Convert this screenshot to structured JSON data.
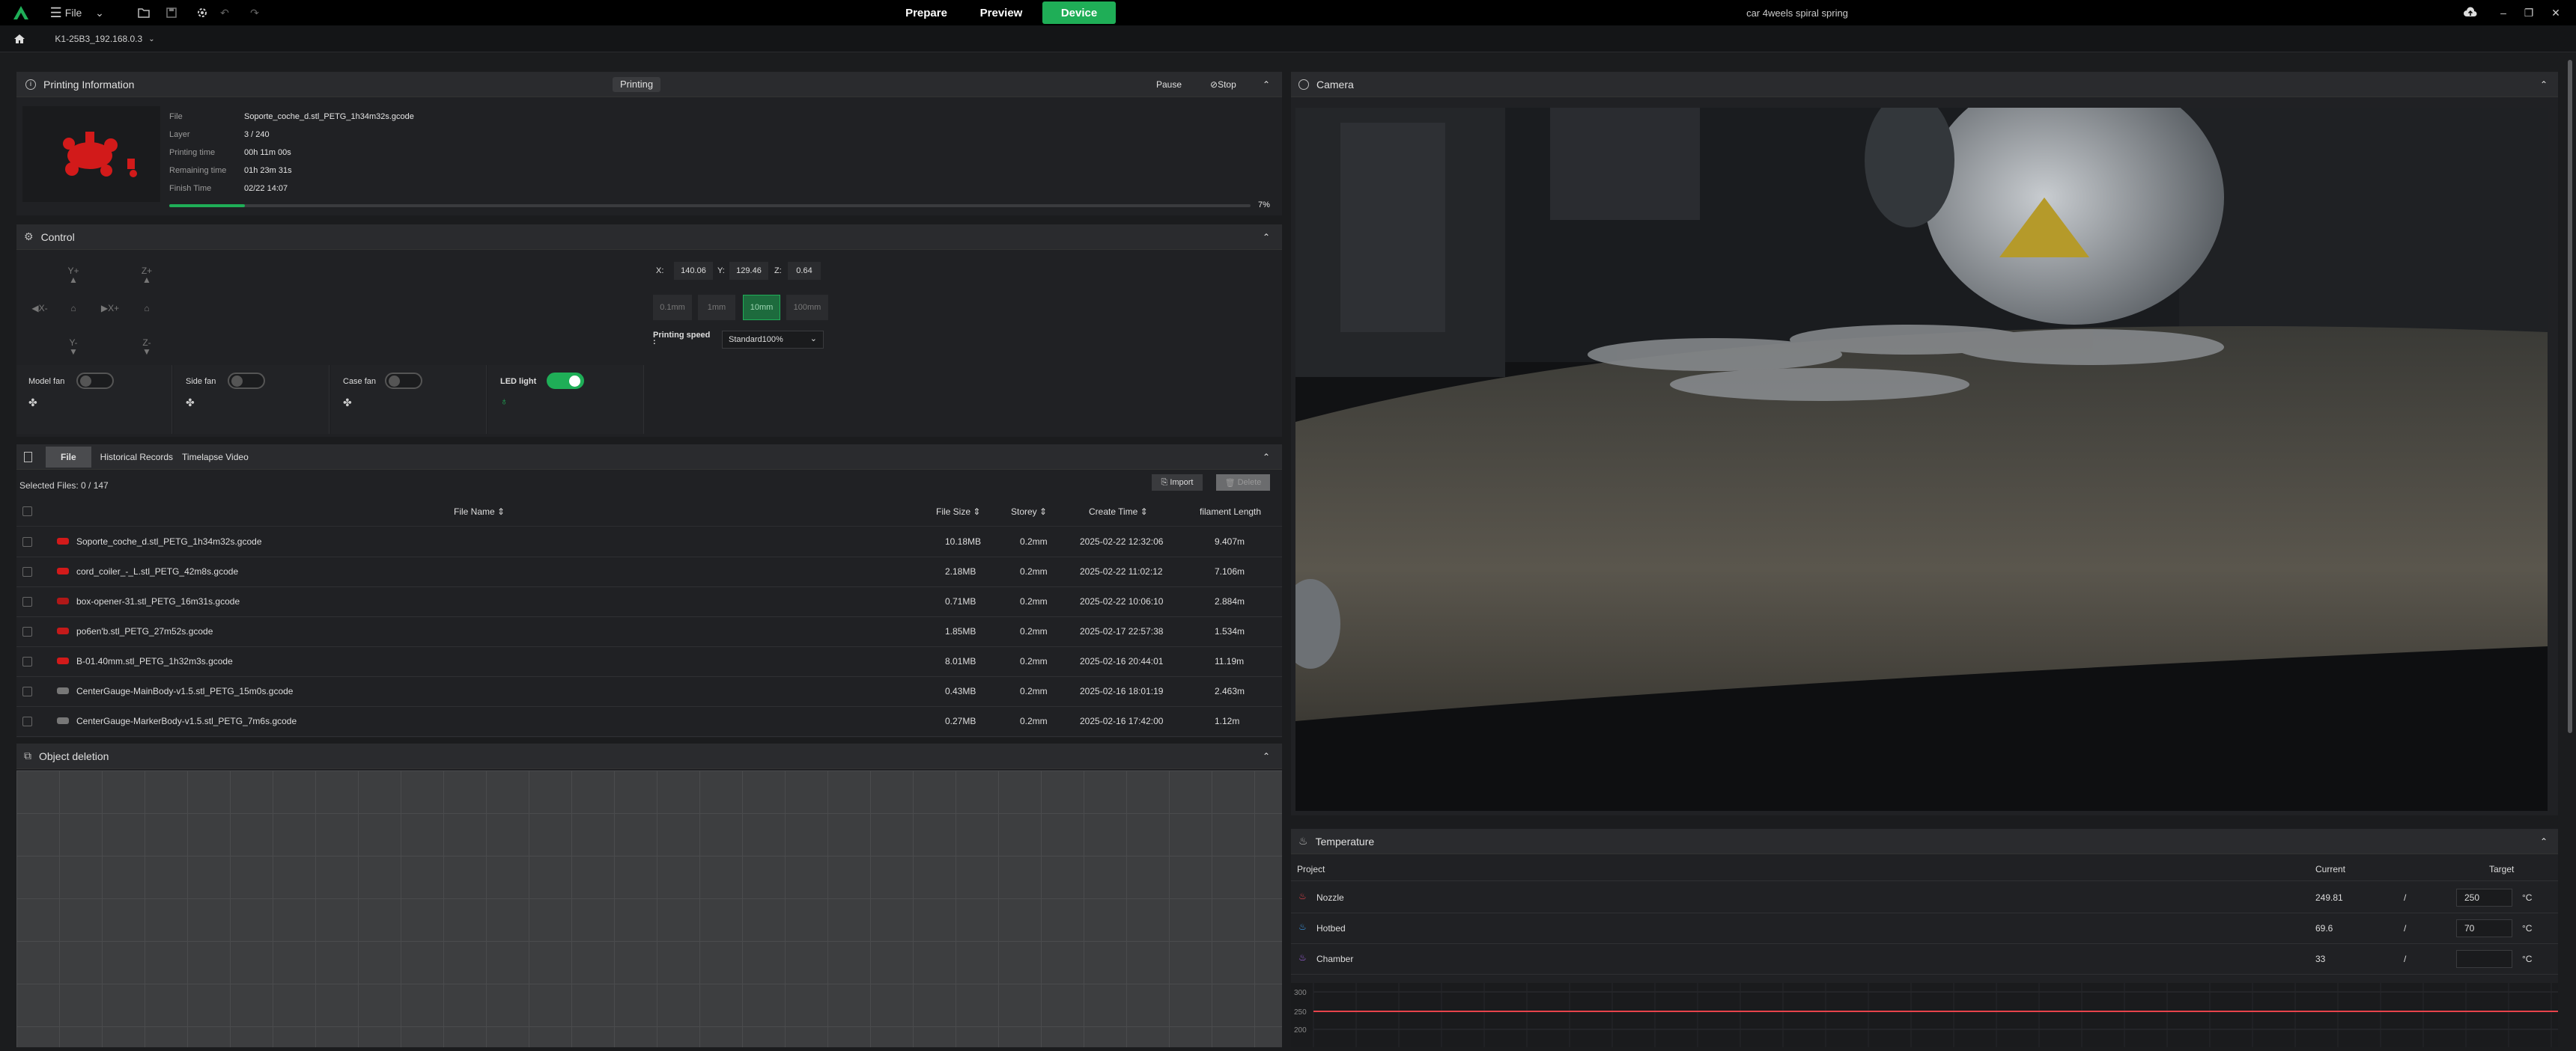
{
  "topbar": {
    "file_menu": "File",
    "tabs": [
      "Prepare",
      "Preview",
      "Device"
    ],
    "active_tab": "Device",
    "project_title": "car 4weels spiral spring"
  },
  "subbar": {
    "device_name": "K1-25B3_192.168.0.3"
  },
  "printing": {
    "title": "Printing Information",
    "status": "Printing",
    "pause": "Pause",
    "stop": "Stop",
    "labels": [
      "File",
      "Layer",
      "Printing time",
      "Remaining time",
      "Finish Time"
    ],
    "values": [
      "Soporte_coche_d.stl_PETG_1h34m32s.gcode",
      "3 / 240",
      "00h 11m 00s",
      "01h 23m 31s",
      "02/22 14:07"
    ],
    "progress_text": "7%",
    "progress": 0.07
  },
  "control": {
    "title": "Control",
    "jog": {
      "y_plus": "Y+",
      "y_minus": "Y-",
      "x_minus": "X-",
      "x_plus": "X+",
      "z_plus": "Z+",
      "z_minus": "Z-"
    },
    "coords": {
      "x_label": "X:",
      "x": "140.06",
      "y_label": "Y:",
      "y": "129.46",
      "z_label": "Z:",
      "z": "0.64"
    },
    "steps": [
      "0.1mm",
      "1mm",
      "10mm",
      "100mm"
    ],
    "active_step": "10mm",
    "speed_label": "Printing speed",
    "speed_colon": ":",
    "speed_value": "Standard100%",
    "fans": [
      {
        "label": "Model fan",
        "on": false
      },
      {
        "label": "Side fan",
        "on": false
      },
      {
        "label": "Case fan",
        "on": false
      },
      {
        "label": "LED light",
        "on": true
      }
    ]
  },
  "files": {
    "tabs": [
      "File",
      "Historical Records",
      "Timelapse Video"
    ],
    "selected": "Selected Files: 0 / 147",
    "import": "Import",
    "delete": "Delete",
    "columns": [
      "File Name",
      "File Size",
      "Storey",
      "Create Time",
      "filament Length"
    ],
    "rows": [
      [
        "Soporte_coche_d.stl_PETG_1h34m32s.gcode",
        "10.18MB",
        "0.2mm",
        "2025-02-22 12:32:06",
        "9.407m"
      ],
      [
        "cord_coiler_-_L.stl_PETG_42m8s.gcode",
        "2.18MB",
        "0.2mm",
        "2025-02-22 11:02:12",
        "7.106m"
      ],
      [
        "box-opener-31.stl_PETG_16m31s.gcode",
        "0.71MB",
        "0.2mm",
        "2025-02-22 10:06:10",
        "2.884m"
      ],
      [
        "po6en'b.stl_PETG_27m52s.gcode",
        "1.85MB",
        "0.2mm",
        "2025-02-17 22:57:38",
        "1.534m"
      ],
      [
        "B-01.40mm.stl_PETG_1h32m3s.gcode",
        "8.01MB",
        "0.2mm",
        "2025-02-16 20:44:01",
        "11.19m"
      ],
      [
        "CenterGauge-MainBody-v1.5.stl_PETG_15m0s.gcode",
        "0.43MB",
        "0.2mm",
        "2025-02-16 18:01:19",
        "2.463m"
      ],
      [
        "CenterGauge-MarkerBody-v1.5.stl_PETG_7m6s.gcode",
        "0.27MB",
        "0.2mm",
        "2025-02-16 17:42:00",
        "1.12m"
      ]
    ]
  },
  "object_deletion": {
    "title": "Object deletion"
  },
  "camera": {
    "title": "Camera"
  },
  "temperature": {
    "title": "Temperature",
    "columns": [
      "Project",
      "Current",
      "Target"
    ],
    "rows": [
      {
        "name": "Nozzle",
        "current": "249.81",
        "sep": "/",
        "target": "250",
        "unit": "°C",
        "color": "#e8434b"
      },
      {
        "name": "Hotbed",
        "current": "69.6",
        "sep": "/",
        "target": "70",
        "unit": "°C",
        "color": "#3d9be9"
      },
      {
        "name": "Chamber",
        "current": "33",
        "sep": "/",
        "target": "",
        "unit": "°C",
        "color": "#a463e8"
      }
    ],
    "chart_ticks": [
      "300",
      "250",
      "200"
    ]
  },
  "colors": {
    "accent": "#1fae57",
    "nozzle_line": "#e8434b"
  }
}
